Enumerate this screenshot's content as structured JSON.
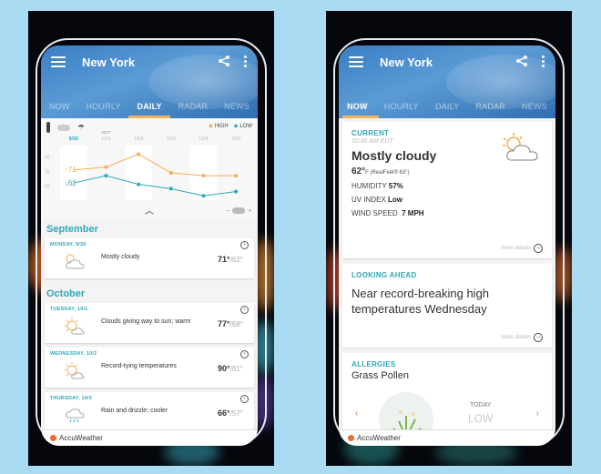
{
  "left_phone": {
    "header": {
      "city": "New York"
    },
    "tabs": [
      {
        "label": "NOW"
      },
      {
        "label": "HOURLY"
      },
      {
        "label": "DAILY",
        "active": true
      },
      {
        "label": "RADAR"
      },
      {
        "label": "NEWS"
      }
    ],
    "graph": {
      "legend_high": "HIGH",
      "legend_low": "LOW",
      "month_marker": "OCT",
      "current_high": "↑71",
      "current_low": "↓62",
      "y_ticks": [
        "80",
        "70",
        "60"
      ],
      "colors": {
        "high": "#f5ae52",
        "low": "#2fa8b8"
      }
    },
    "chart_data": {
      "type": "line",
      "title": "",
      "categories": [
        "9/30",
        "10/1",
        "10/2",
        "10/3",
        "10/4",
        "10/5"
      ],
      "series": [
        {
          "name": "HIGH",
          "values": [
            71,
            73,
            82,
            69,
            67,
            67
          ]
        },
        {
          "name": "LOW",
          "values": [
            62,
            67,
            61,
            58,
            53,
            56
          ]
        }
      ],
      "xlabel": "",
      "ylabel": "",
      "ylim": [
        50,
        88
      ],
      "legend": "top-right"
    },
    "sections": [
      {
        "month": "September",
        "days": [
          {
            "date": "MONDAY, 9/30",
            "icon": "partly-cloudy-icon",
            "desc": "Mostly cloudy",
            "high": "71°",
            "low": "/62°"
          }
        ]
      },
      {
        "month": "October",
        "days": [
          {
            "date": "TUESDAY, 10/1",
            "icon": "sun-cloud-icon",
            "desc": "Clouds giving way to sun; warm",
            "high": "77°",
            "low": "/68°"
          },
          {
            "date": "WEDNESDAY, 10/2",
            "icon": "sun-cloud-icon",
            "desc": "Record-tying temperatures",
            "high": "90°",
            "low": "/61°"
          },
          {
            "date": "THURSDAY, 10/3",
            "icon": "rain-icon",
            "desc": "Rain and drizzle; cooler",
            "high": "66°",
            "low": "/57°"
          }
        ]
      }
    ],
    "footer": {
      "brand": "AccuWeather"
    }
  },
  "right_phone": {
    "header": {
      "city": "New York"
    },
    "tabs": [
      {
        "label": "NOW",
        "active": true
      },
      {
        "label": "HOURLY"
      },
      {
        "label": "DAILY"
      },
      {
        "label": "RADAR"
      },
      {
        "label": "NEWS"
      }
    ],
    "current": {
      "label": "CURRENT",
      "time": "10:46 AM EDT",
      "condition": "Mostly cloudy",
      "temp": "62°",
      "unit_realfeel": "F (RealFeel® 63°)",
      "humidity_label": "HUMIDITY",
      "humidity_value": "57%",
      "uv_label": "UV INDEX",
      "uv_value": "Low",
      "wind_label": "WIND SPEED",
      "wind_value": "7 MPH",
      "more": "more details"
    },
    "looking_ahead": {
      "label": "LOOKING AHEAD",
      "headline": "Near record-breaking high temperatures Wednesday",
      "more": "more details"
    },
    "allergies": {
      "label": "ALLERGIES",
      "type": "Grass Pollen",
      "day": "TODAY",
      "level": "LOW"
    },
    "footer": {
      "brand": "AccuWeather"
    }
  }
}
